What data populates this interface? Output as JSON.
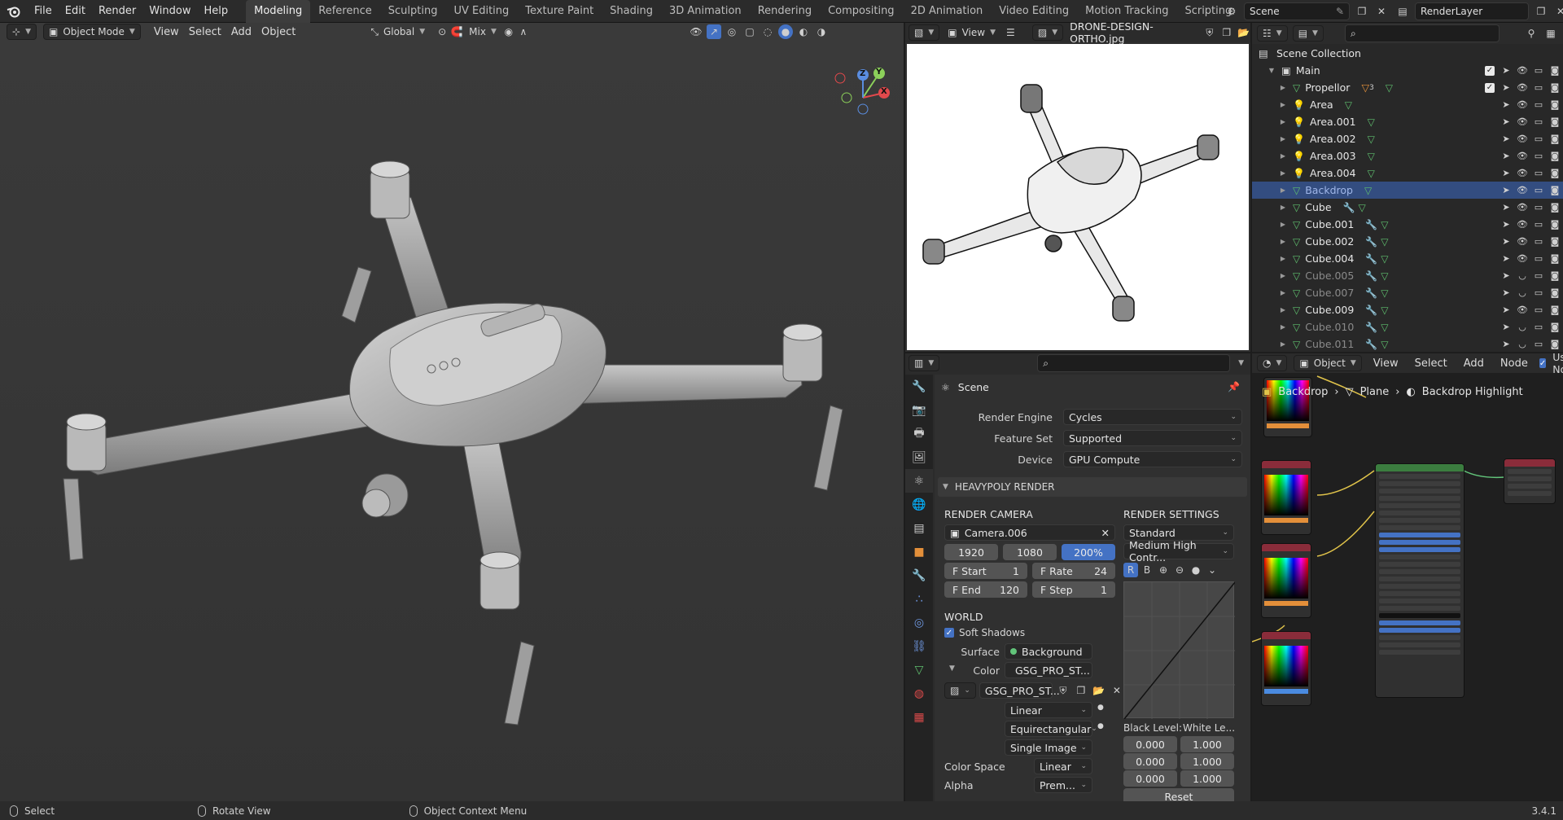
{
  "topbar": {
    "menus": [
      "File",
      "Edit",
      "Render",
      "Window",
      "Help"
    ],
    "workspaces": [
      "Modeling",
      "Reference",
      "Sculpting",
      "UV Editing",
      "Texture Paint",
      "Shading",
      "3D Animation",
      "Rendering",
      "Compositing",
      "2D Animation",
      "Video Editing",
      "Motion Tracking",
      "Scripting"
    ],
    "active_workspace": "Modeling",
    "scene": "Scene",
    "view_layer": "RenderLayer"
  },
  "viewport": {
    "mode": "Object Mode",
    "menus": [
      "View",
      "Select",
      "Add",
      "Object"
    ],
    "transform_orientation": "Global",
    "snap_mix": "Mix",
    "gizmo": {
      "x": "X",
      "y": "Y",
      "z": "Z"
    }
  },
  "image_editor": {
    "view_label": "View",
    "filename": "DRONE-DESIGN-ORTHO.jpg"
  },
  "outliner": {
    "root": "Scene Collection",
    "collection": "Main",
    "items": [
      {
        "name": "Propellor",
        "type": "mesh",
        "badge": "3",
        "state": "normal"
      },
      {
        "name": "Area",
        "type": "light",
        "state": "normal"
      },
      {
        "name": "Area.001",
        "type": "light",
        "state": "normal"
      },
      {
        "name": "Area.002",
        "type": "light",
        "state": "normal"
      },
      {
        "name": "Area.003",
        "type": "light",
        "state": "normal"
      },
      {
        "name": "Area.004",
        "type": "light",
        "state": "normal"
      },
      {
        "name": "Backdrop",
        "type": "mesh",
        "state": "selected"
      },
      {
        "name": "Cube",
        "type": "mesh",
        "state": "normal"
      },
      {
        "name": "Cube.001",
        "type": "mesh",
        "state": "normal"
      },
      {
        "name": "Cube.002",
        "type": "mesh",
        "state": "normal"
      },
      {
        "name": "Cube.004",
        "type": "mesh",
        "state": "normal"
      },
      {
        "name": "Cube.005",
        "type": "mesh",
        "state": "hidden"
      },
      {
        "name": "Cube.007",
        "type": "mesh",
        "state": "hidden"
      },
      {
        "name": "Cube.009",
        "type": "mesh",
        "state": "normal"
      },
      {
        "name": "Cube.010",
        "type": "mesh",
        "state": "hidden"
      },
      {
        "name": "Cube.011",
        "type": "mesh",
        "state": "hidden"
      }
    ]
  },
  "properties": {
    "context": "Scene",
    "render_engine_label": "Render Engine",
    "render_engine": "Cycles",
    "feature_set_label": "Feature Set",
    "feature_set": "Supported",
    "device_label": "Device",
    "device": "GPU Compute",
    "panel_title": "HEAVYPOLY RENDER",
    "render_camera_label": "RENDER CAMERA",
    "camera": "Camera.006",
    "res_x": "1920",
    "res_y": "1080",
    "res_pct": "200%",
    "f_start_label": "F Start",
    "f_start": "1",
    "f_rate_label": "F Rate",
    "f_rate": "24",
    "f_end_label": "F End",
    "f_end": "120",
    "f_step_label": "F Step",
    "f_step": "1",
    "render_settings_label": "RENDER SETTINGS",
    "view_transform": "Standard",
    "look": "Medium High Contr...",
    "curve_r": "R",
    "curve_b": "B",
    "world_label": "WORLD",
    "soft_shadows": "Soft Shadows",
    "surface_label": "Surface",
    "surface": "Background",
    "color_label": "Color",
    "color_value": "GSG_PRO_ST...",
    "image_name": "GSG_PRO_ST...",
    "interp": "Linear",
    "projection": "Equirectangular",
    "source": "Single Image",
    "color_space_label": "Color Space",
    "color_space": "Linear",
    "alpha_label": "Alpha",
    "alpha": "Prem...",
    "black_level_label": "Black Level:",
    "white_level_label": "White Le...",
    "levels": [
      [
        "0.000",
        "1.000"
      ],
      [
        "0.000",
        "1.000"
      ],
      [
        "0.000",
        "1.000"
      ]
    ],
    "reset": "Reset"
  },
  "node_editor": {
    "object_mode": "Object",
    "menus": [
      "View",
      "Select",
      "Add",
      "Node"
    ],
    "use_nodes": "Use No",
    "breadcrumb": [
      "Backdrop",
      "Plane",
      "Backdrop Highlight"
    ]
  },
  "status": {
    "select": "Select",
    "rotate": "Rotate View",
    "context_menu": "Object Context Menu",
    "version": "3.4.1"
  },
  "colors": {
    "accent": "#4472c4",
    "selection": "#334d80",
    "viewport_bg": "#3a3a3a"
  }
}
